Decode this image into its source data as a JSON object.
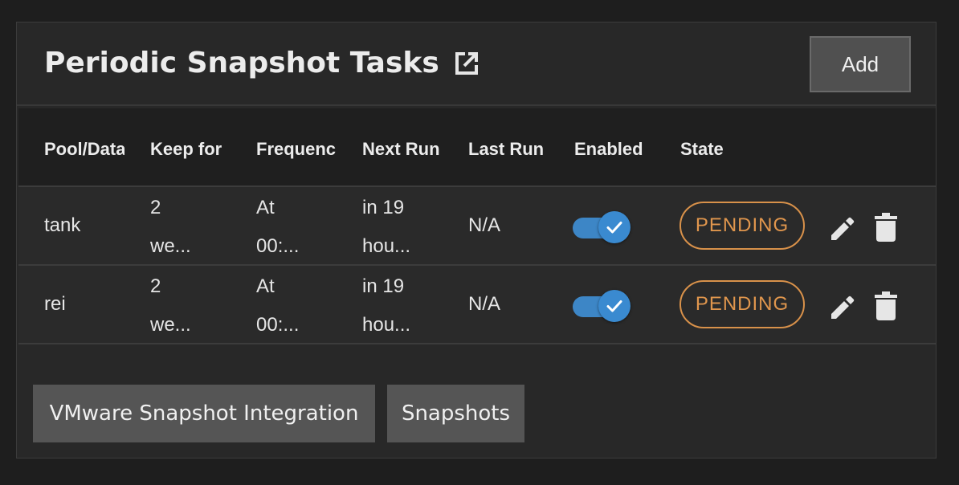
{
  "header": {
    "title": "Periodic Snapshot Tasks",
    "open_icon": "open-in-new-icon",
    "add_label": "Add"
  },
  "table": {
    "columns": [
      "Pool/Data",
      "Keep for",
      "Frequenc",
      "Next Run",
      "Last Run",
      "Enabled",
      "State"
    ],
    "rows": [
      {
        "pool": "tank",
        "keep_line1": "2",
        "keep_line2": "we...",
        "freq_line1": "At",
        "freq_line2": "00:...",
        "next_line1": "in 19",
        "next_line2": "hou...",
        "last_run": "N/A",
        "enabled": true,
        "state": "PENDING"
      },
      {
        "pool": "rei",
        "keep_line1": "2",
        "keep_line2": "we...",
        "freq_line1": "At",
        "freq_line2": "00:...",
        "next_line1": "in 19",
        "next_line2": "hou...",
        "last_run": "N/A",
        "enabled": true,
        "state": "PENDING"
      }
    ]
  },
  "footer": {
    "vmware_label": "VMware Snapshot Integration",
    "snapshots_label": "Snapshots"
  },
  "colors": {
    "background": "#1e1e1e",
    "card": "#282828",
    "accent_blue": "#3a8ad0",
    "pending_orange": "#e0964d",
    "button_gray": "#555555"
  }
}
